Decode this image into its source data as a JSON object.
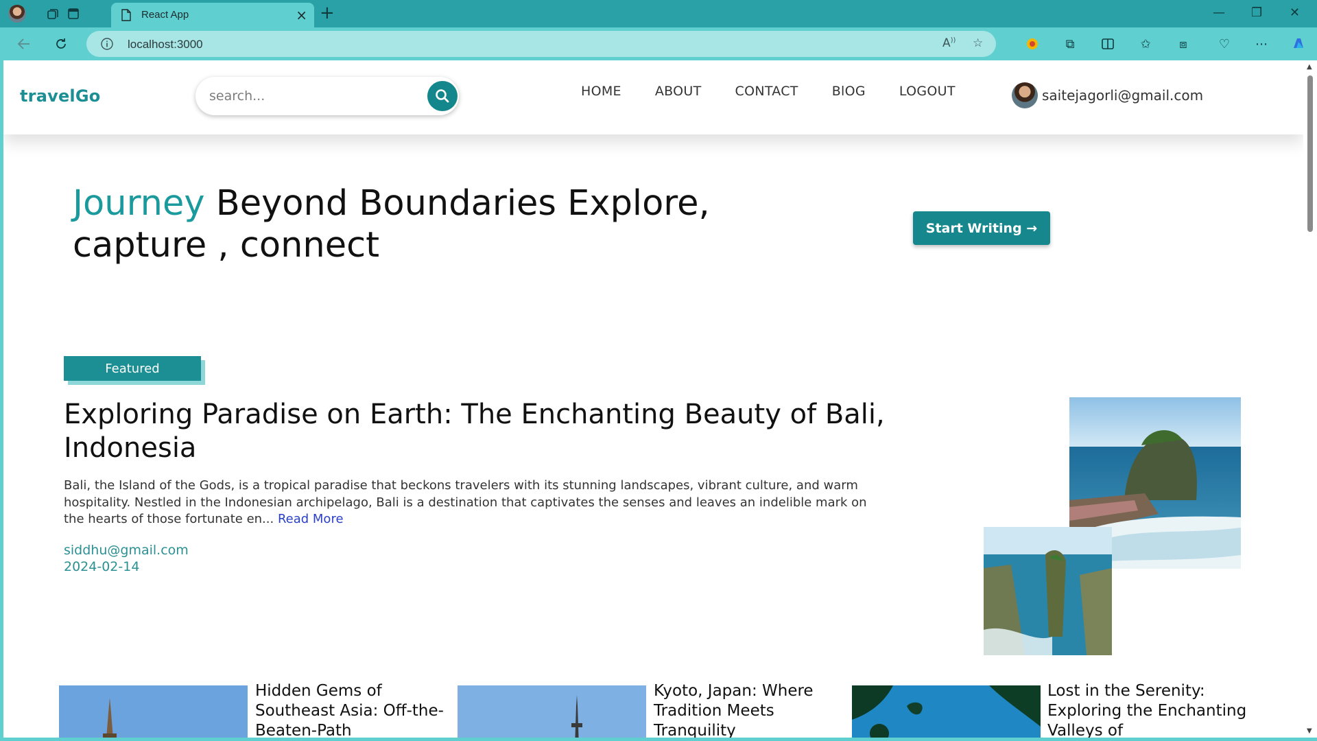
{
  "browser": {
    "tab_title": "React App",
    "url": "localhost:3000",
    "new_tab_symbol": "+",
    "close_tab_symbol": "×",
    "window_controls": [
      "—",
      "❐",
      "✕"
    ]
  },
  "site": {
    "logo": "travelGo",
    "search": {
      "placeholder": "search..."
    },
    "nav": [
      "HOME",
      "ABOUT",
      "CONTACT",
      "BlOG",
      "LOGOUT"
    ],
    "user_email": "saitejagorli@gmail.com"
  },
  "hero": {
    "accent_word": "Journey",
    "title_rest": " Beyond Boundaries Explore, capture , connect",
    "cta": "Start Writing →"
  },
  "featured": {
    "badge": "Featured",
    "title": "Exploring Paradise on Earth: The Enchanting Beauty of Bali, Indonesia",
    "excerpt": "Bali, the Island of the Gods, is a tropical paradise that beckons travelers with its stunning landscapes, vibrant culture, and warm hospitality. Nestled in the Indonesian archipelago, Bali is a destination that captivates the senses and leaves an indelible mark on the hearts of those fortunate en...",
    "read_more": "Read More",
    "author": "siddhu@gmail.com",
    "date": "2024-02-14"
  },
  "cards": [
    {
      "title": "Hidden Gems of Southeast Asia: Off-the-Beaten-Path"
    },
    {
      "title": "Kyoto, Japan: Where Tradition Meets Tranquility"
    },
    {
      "title": "Lost in the Serenity: Exploring the Enchanting Valleys of"
    }
  ],
  "colors": {
    "accent": "#1b8f93",
    "browser_frame": "#5fcfd0",
    "titlebar": "#2aa1a6",
    "link": "#2a3fc9"
  }
}
